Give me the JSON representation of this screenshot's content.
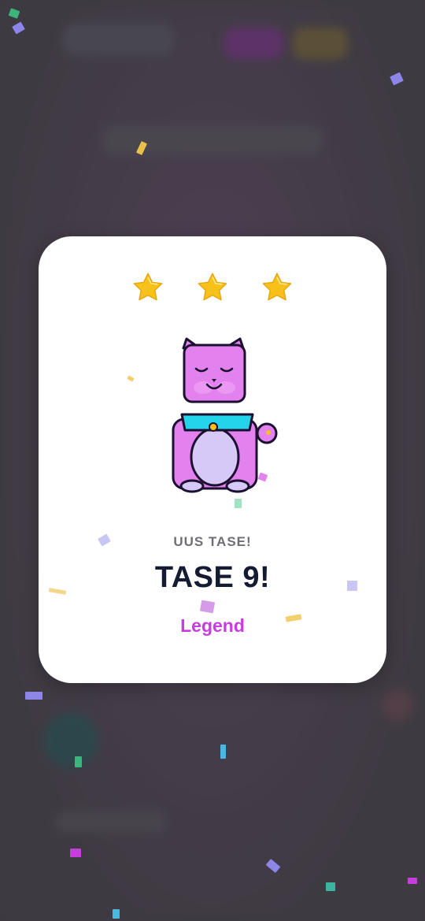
{
  "modal": {
    "subtitle": "UUS TASE!",
    "title": "TASE 9!",
    "rank": "Legend",
    "stars": [
      "star-icon",
      "star-icon",
      "star-icon"
    ],
    "mascot": "cat-mascot-icon"
  },
  "colors": {
    "title": "#141b33",
    "subtitle": "#6e6e76",
    "rank": "#c53edd",
    "star": "#f6c21a",
    "cat_body": "#e382ef",
    "cat_belly": "#d6c8f7",
    "collar": "#24d4ea"
  }
}
